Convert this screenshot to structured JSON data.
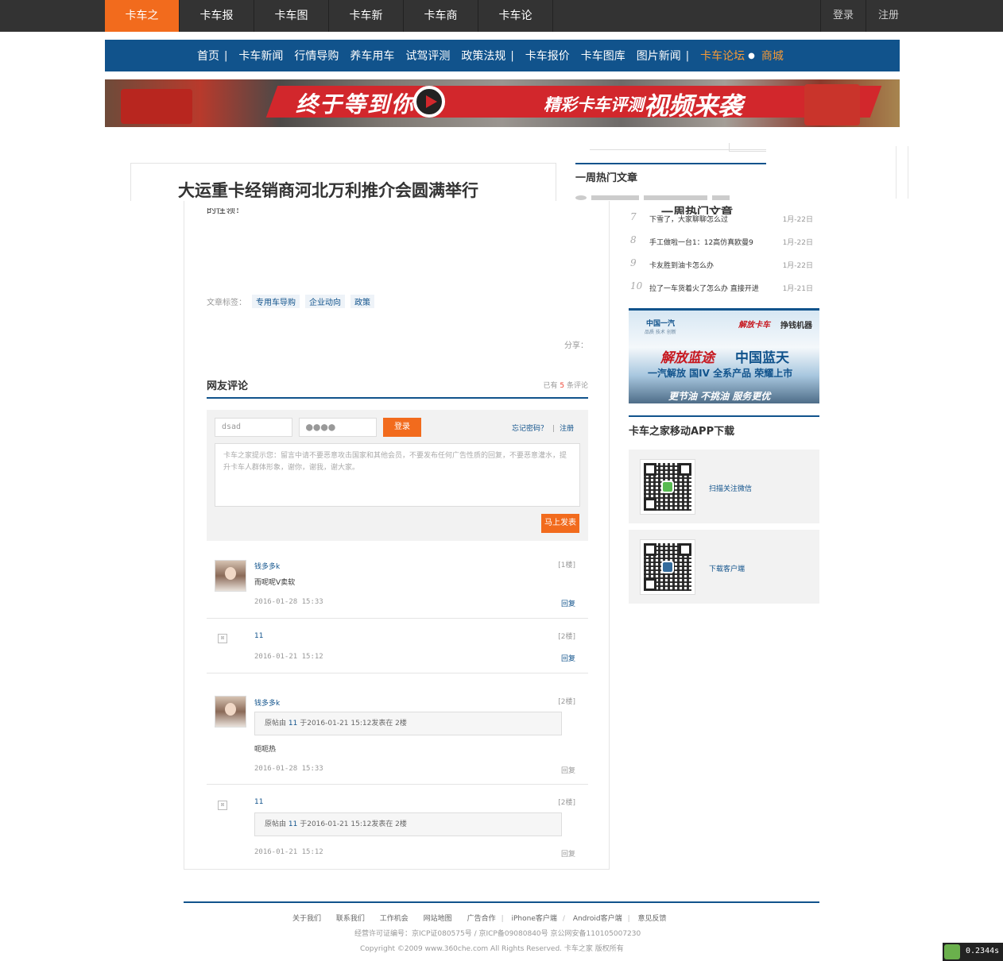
{
  "topnav": {
    "items": [
      "卡车之家",
      "卡车报价",
      "卡车图库",
      "卡车新闻",
      "卡车商城",
      "卡车论坛"
    ],
    "login": "登录",
    "register": "注册"
  },
  "bluenav": {
    "items": [
      "首页",
      "卡车新闻",
      "行情导购",
      "养车用车",
      "试驾评测",
      "政策法规",
      "卡车报价",
      "卡车图库",
      "图片新闻",
      "卡车论坛",
      "商城"
    ],
    "sep": "|"
  },
  "banner": {
    "text1": "终于等到你",
    "text2": "精彩卡车评测",
    "text3": "视频来袭"
  },
  "article": {
    "title": "大运重卡经销商河北万利推介会圆满举行",
    "cut_text": "的性领！",
    "tags_label": "文章标签：",
    "tags": [
      "专用车导购",
      "企业动向",
      "政策"
    ],
    "share_label": "分享："
  },
  "comments": {
    "heading": "网友评论",
    "count_prefix": "已有",
    "count": "5",
    "count_suffix": "条评论",
    "form": {
      "username_value": "dsad",
      "password_value": "●●●●",
      "login_button": "登录",
      "forgot": "忘记密码？",
      "separator": "|",
      "register": "注册",
      "notice": "卡车之家提示您：留言中请不要恶意攻击国家和其他会员，不要发布任何广告性质的回复，不要恶意灌水，提升卡车人群体形象，谢你，谢我，谢大家。",
      "post_button": "马上发表"
    },
    "items": [
      {
        "user": "钱多多k",
        "floor": "[1楼]",
        "text": "而呢呢V卖软",
        "time": "2016-01-28 15:33",
        "reply": "回复"
      },
      {
        "user": "11",
        "floor": "[2楼]",
        "text": "",
        "time": "2016-01-21 15:12",
        "reply": "回复"
      },
      {
        "user": "钱多多k",
        "floor": "[2楼]",
        "quote_prefix": "原帖由",
        "quote_user": "11",
        "quote_suffix": "于2016-01-21 15:12发表在 2楼",
        "text": "呃呃热",
        "time": "2016-01-28 15:33",
        "reply": "回复"
      },
      {
        "user": "11",
        "floor": "[2楼]",
        "quote_prefix": "原帖由",
        "quote_user": "11",
        "quote_suffix": "于2016-01-21 15:12发表在 2楼",
        "time": "2016-01-21 15:12",
        "reply": "回复"
      }
    ]
  },
  "sidebar": {
    "hot_heading": "一周热门文章",
    "hot_heading_dup": "一周热门文章",
    "hot_items": [
      {
        "num": "7",
        "title": "下雪了，大家聊聊怎么过",
        "date": "1月-22日"
      },
      {
        "num": "8",
        "title": "手工做啦一台1：12高仿真欧曼9",
        "date": "1月-22日"
      },
      {
        "num": "9",
        "title": "卡友胜到油卡怎么办",
        "date": "1月-22日"
      },
      {
        "num": "10",
        "title": "拉了一车货着火了怎么办 直接开进",
        "date": "1月-21日"
      }
    ],
    "ad": {
      "brand1": "中国一汽",
      "brand1_sub": "品质 技术 创新",
      "brand2": "解放卡车",
      "slogan_top": "挣钱机器",
      "line1a": "解放蓝途",
      "line1b": "中国蓝天",
      "line2": "一汽解放 国IV 全系产品  荣耀上市",
      "line3": "更节油 不挑油 服务更优"
    },
    "app_heading": "卡车之家移动APP下载",
    "app_items": [
      {
        "label": "扫描关注微信"
      },
      {
        "label": "下载客户端"
      }
    ]
  },
  "footer": {
    "links": [
      "关于我们",
      "联系我们",
      "工作机会",
      "网站地图",
      "广告合作"
    ],
    "iphone": "iPhone客户端",
    "android": "Android客户端",
    "feedback": "意见反馈",
    "icp": "经营许可证编号：京ICP证080575号 / 京ICP备09080840号 京公网安备110105007230",
    "copyright": "Copyright ©2009 www.360che.com All Rights Reserved.   卡车之家   版权所有"
  },
  "perf": {
    "value": "0.2344s"
  }
}
